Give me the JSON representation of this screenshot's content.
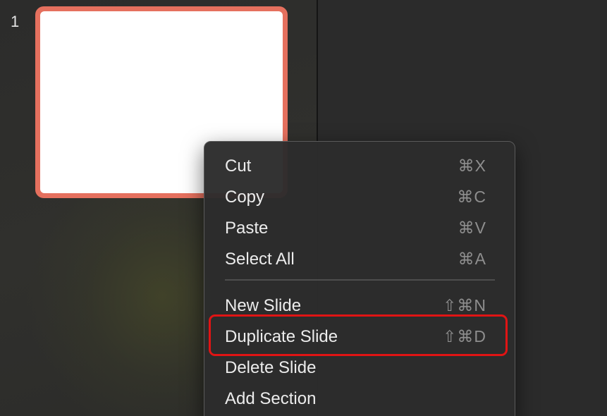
{
  "slide_panel": {
    "slide_number": "1"
  },
  "context_menu": {
    "items": [
      {
        "label": "Cut",
        "shortcut": "⌘X"
      },
      {
        "label": "Copy",
        "shortcut": "⌘C"
      },
      {
        "label": "Paste",
        "shortcut": "⌘V"
      },
      {
        "label": "Select All",
        "shortcut": "⌘A"
      },
      {
        "label": "New Slide",
        "shortcut": "⇧⌘N"
      },
      {
        "label": "Duplicate Slide",
        "shortcut": "⇧⌘D"
      },
      {
        "label": "Delete Slide",
        "shortcut": ""
      },
      {
        "label": "Add Section",
        "shortcut": ""
      }
    ]
  },
  "colors": {
    "selection_border": "#e5705e",
    "highlight_annotation": "#e01414",
    "menu_background": "#2c2c2c"
  }
}
